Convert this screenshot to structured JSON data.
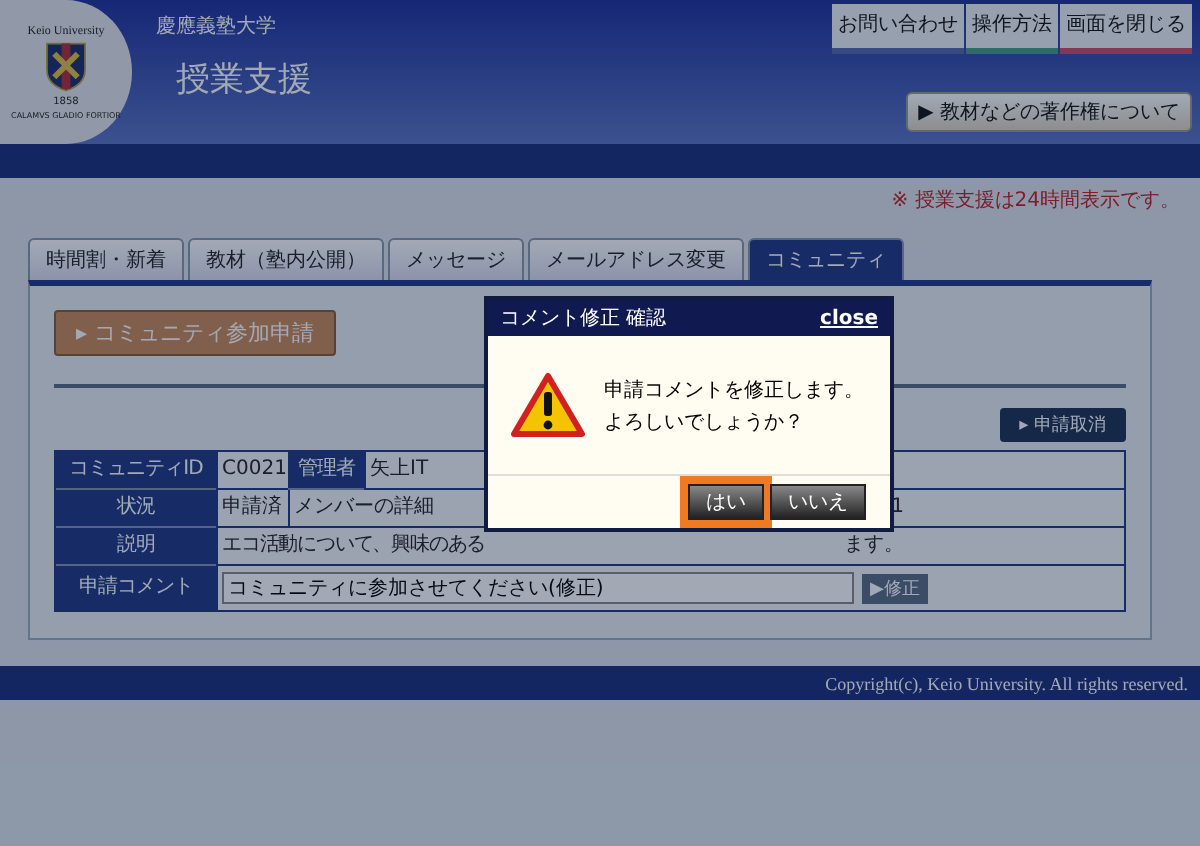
{
  "logo": {
    "name": "Keio University",
    "year": "1858",
    "motto": "CALAMVS GLADIO FORTIOR"
  },
  "header": {
    "university": "慶應義塾大学",
    "title": "授業支援",
    "top_buttons": [
      "お問い合わせ",
      "操作方法",
      "画面を閉じる"
    ],
    "copyright_button": "▶ 教材などの著作権について"
  },
  "notice": "※  授業支援は24時間表示です。",
  "tabs": [
    {
      "label": "時間割・新着",
      "selected": false
    },
    {
      "label": "教材（塾内公開）",
      "selected": false
    },
    {
      "label": "メッセージ",
      "selected": false
    },
    {
      "label": "メールアドレス変更",
      "selected": false
    },
    {
      "label": "コミュニティ",
      "selected": true
    }
  ],
  "join_button": "▸ コミュニティ参加申請",
  "cancel_button": "▸ 申請取消",
  "details": {
    "id_label": "コミュニティID",
    "id": "C0021",
    "admin_label": "管理者",
    "admin": "矢上IT",
    "status_label": "状況",
    "status": "申請済",
    "status_note": "メンバーの詳細",
    "status_note_end": "1",
    "desc_label": "説明",
    "desc": "エコ活動について、興味のある",
    "desc_end": "ます。",
    "comment_label": "申請コメント",
    "comment": "コミュニティに参加させてください(修正)",
    "fix_button": "▶修正"
  },
  "footer": "Copyright(c), Keio University. All rights reserved.",
  "dialog": {
    "title": "コメント修正 確認",
    "close": "close",
    "message": [
      "申請コメントを修正します。",
      "よろしいでしょうか？"
    ],
    "buttons": [
      {
        "label": "はい",
        "selected": true
      },
      {
        "label": "いいえ",
        "selected": false
      }
    ]
  }
}
